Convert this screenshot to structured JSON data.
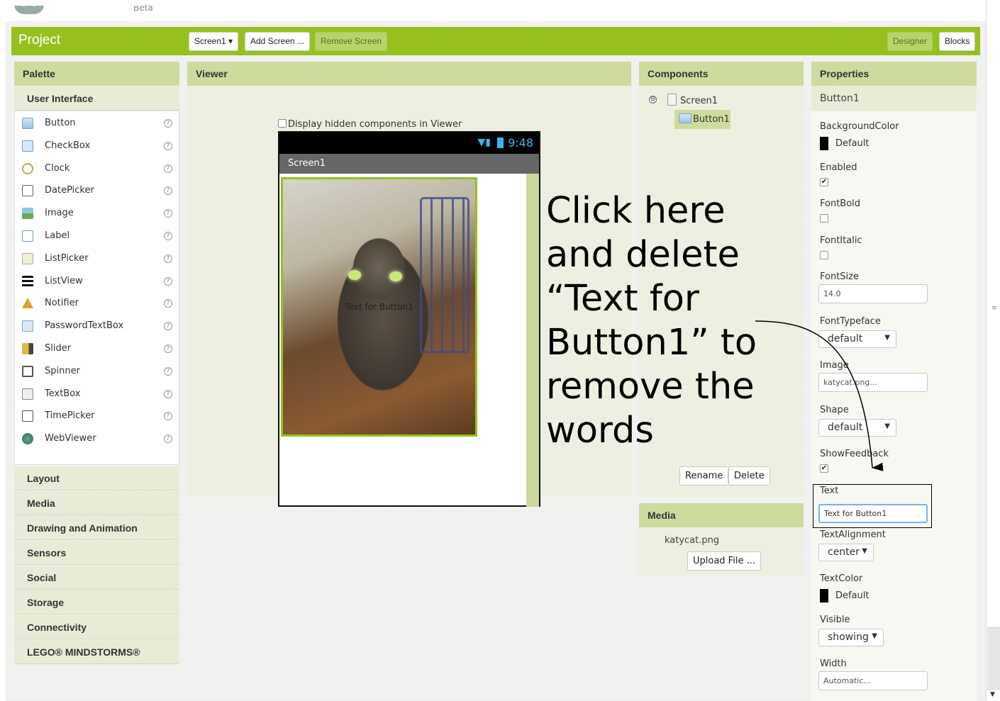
{
  "header": {
    "beta": "Beta"
  },
  "toolbar": {
    "project_title": "Project",
    "screen_select": "Screen1 ▾",
    "add_screen": "Add Screen ...",
    "remove_screen": "Remove Screen",
    "designer": "Designer",
    "blocks": "Blocks"
  },
  "palette": {
    "title": "Palette",
    "open_category": "User Interface",
    "items": [
      {
        "label": "Button",
        "icon": "button-icon"
      },
      {
        "label": "CheckBox",
        "icon": "checkbox-icon"
      },
      {
        "label": "Clock",
        "icon": "clock-icon"
      },
      {
        "label": "DatePicker",
        "icon": "datepicker-icon"
      },
      {
        "label": "Image",
        "icon": "image-icon"
      },
      {
        "label": "Label",
        "icon": "label-icon"
      },
      {
        "label": "ListPicker",
        "icon": "listpicker-icon"
      },
      {
        "label": "ListView",
        "icon": "listview-icon"
      },
      {
        "label": "Notifier",
        "icon": "notifier-icon"
      },
      {
        "label": "PasswordTextBox",
        "icon": "passwordtextbox-icon"
      },
      {
        "label": "Slider",
        "icon": "slider-icon"
      },
      {
        "label": "Spinner",
        "icon": "spinner-icon"
      },
      {
        "label": "TextBox",
        "icon": "textbox-icon"
      },
      {
        "label": "TimePicker",
        "icon": "timepicker-icon"
      },
      {
        "label": "WebViewer",
        "icon": "webviewer-icon"
      }
    ],
    "help_glyph": "?",
    "categories": [
      "Layout",
      "Media",
      "Drawing and Animation",
      "Sensors",
      "Social",
      "Storage",
      "Connectivity",
      "LEGO® MINDSTORMS®"
    ]
  },
  "viewer": {
    "title": "Viewer",
    "hidden_components_label": "Display hidden components in Viewer",
    "status_time": "9:48",
    "screen_title": "Screen1",
    "button_text": "Text for Button1"
  },
  "components": {
    "title": "Components",
    "collapse_glyph": "⊖",
    "screen": "Screen1",
    "selected": "Button1",
    "rename": "Rename",
    "delete": "Delete"
  },
  "media": {
    "title": "Media",
    "file": "katycat.png",
    "upload": "Upload File ..."
  },
  "properties": {
    "title": "Properties",
    "component": "Button1",
    "background_color_label": "BackgroundColor",
    "background_color_value": "Default",
    "enabled_label": "Enabled",
    "enabled": true,
    "fontbold_label": "FontBold",
    "fontbold": false,
    "fontitalic_label": "FontItalic",
    "fontitalic": false,
    "fontsize_label": "FontSize",
    "fontsize_value": "14.0",
    "fonttypeface_label": "FontTypeface",
    "fonttypeface_value": "default",
    "image_label": "Image",
    "image_value": "katycat.png...",
    "shape_label": "Shape",
    "shape_value": "default",
    "showfeedback_label": "ShowFeedback",
    "showfeedback": true,
    "text_label": "Text",
    "text_value": "Text for Button1",
    "textalignment_label": "TextAlignment",
    "textalignment_value": "center",
    "textcolor_label": "TextColor",
    "textcolor_value": "Default",
    "visible_label": "Visible",
    "visible_value": "showing",
    "width_label": "Width",
    "width_value": "Automatic...",
    "check_glyph": "✔",
    "dropdown_glyph": "▼"
  },
  "annotation": {
    "lines": [
      "Click here",
      "and delete",
      "“Text for",
      "Button1” to",
      "remove the",
      "words"
    ]
  },
  "colors": {
    "accent": "#95c11f",
    "panel_header": "#cddc9e",
    "status_text": "#39b7ea"
  }
}
